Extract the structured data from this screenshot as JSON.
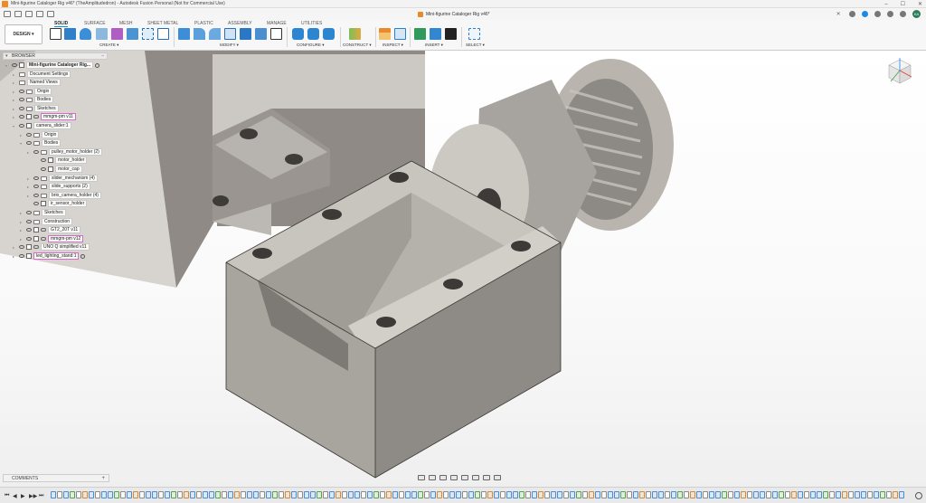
{
  "window": {
    "title": "Mini-figurine Cataloger Rig v46* (TheAmplitudedron) - Autodesk Fusion Personal (Not for Commercial Use)",
    "controls": [
      "–",
      "☐",
      "✕"
    ]
  },
  "document_tab": {
    "label": "Mini-figurine Cataloger Rig v46*",
    "close": "✕"
  },
  "user": {
    "initials": "KA"
  },
  "ribbon": {
    "workspace_button": "DESIGN ▾",
    "tabs": [
      "SOLID",
      "SURFACE",
      "MESH",
      "SHEET METAL",
      "PLASTIC",
      "ASSEMBLY",
      "MANAGE",
      "UTILITIES"
    ],
    "active_tab": "SOLID",
    "groups": [
      "CREATE ▾",
      "MODIFY ▾",
      "CONFIGURE ▾",
      "CONSTRUCT ▾",
      "INSPECT ▾",
      "INSERT ▾",
      "SELECT ▾"
    ]
  },
  "browser": {
    "title": "BROWSER",
    "items": [
      {
        "label": "Mini-figurine Cataloger Rig..."
      },
      {
        "label": "Document Settings"
      },
      {
        "label": "Named Views"
      },
      {
        "label": "Origin"
      },
      {
        "label": "Bodies"
      },
      {
        "label": "Sketches"
      },
      {
        "label": "mmgm-pm v11"
      },
      {
        "label": "camera_slider:1"
      },
      {
        "label": "Origin"
      },
      {
        "label": "Bodies"
      },
      {
        "label": "pulley_motor_holder (2)"
      },
      {
        "label": "motor_holder"
      },
      {
        "label": "motor_cap"
      },
      {
        "label": "slider_mechanism (4)"
      },
      {
        "label": "slide_supports (2)"
      },
      {
        "label": "brio_camera_holder (4)"
      },
      {
        "label": "ir_sensor_holder"
      },
      {
        "label": "Sketches"
      },
      {
        "label": "Construction"
      },
      {
        "label": "GT2_20T v11"
      },
      {
        "label": "mmgm-pm v12"
      },
      {
        "label": "UNO Q simplified v11"
      },
      {
        "label": "led_lighting_stand:1"
      }
    ]
  },
  "comments": {
    "label": "COMMENTS",
    "add": "+"
  },
  "timeline": {
    "controls": [
      "⏮",
      "◀",
      "▶",
      "▶▶",
      "⏭"
    ]
  }
}
